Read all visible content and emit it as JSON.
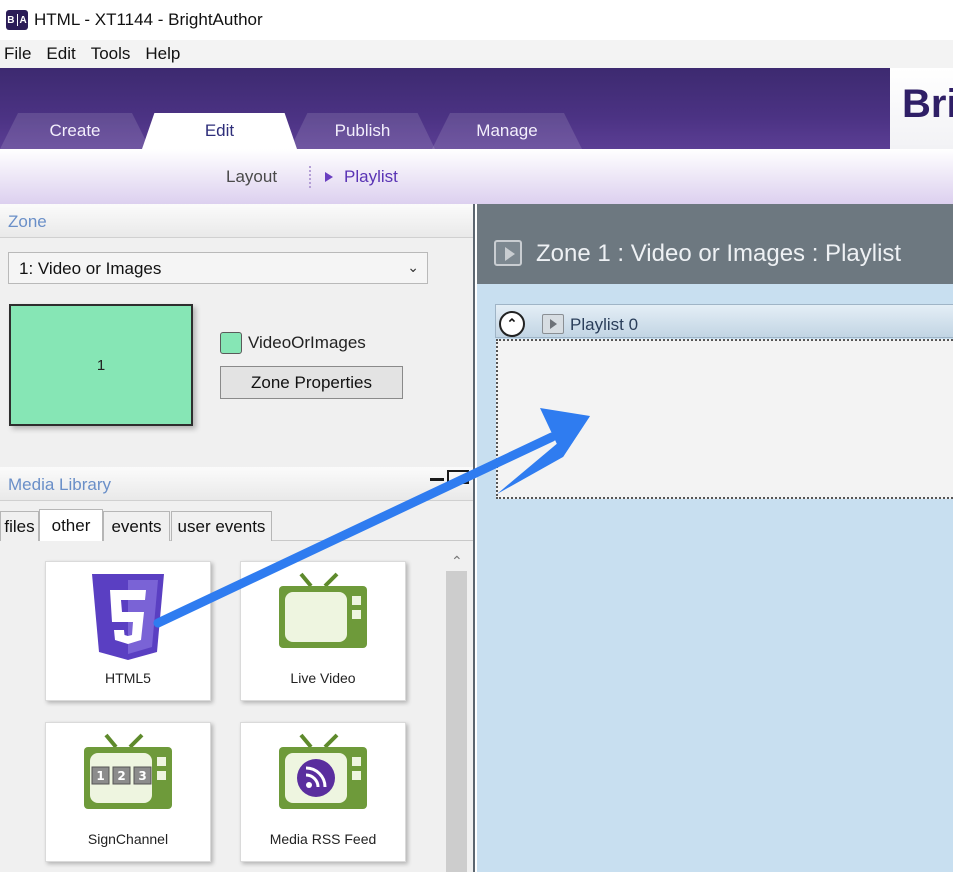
{
  "window": {
    "icon_text_a": "B",
    "icon_text_b": "A",
    "title": "HTML - XT1144 - BrightAuthor"
  },
  "menu": [
    "File",
    "Edit",
    "Tools",
    "Help"
  ],
  "brand": {
    "text": "Bri"
  },
  "tabs": [
    {
      "label": "Create",
      "active": false
    },
    {
      "label": "Edit",
      "active": true
    },
    {
      "label": "Publish",
      "active": false
    },
    {
      "label": "Manage",
      "active": false
    }
  ],
  "subnav": {
    "layout": "Layout",
    "playlist": "Playlist"
  },
  "zone_panel": {
    "header": "Zone",
    "selected_zone": "1: Video or Images",
    "preview_label": "1",
    "zone_type": "VideoOrImages",
    "properties_button": "Zone Properties",
    "zone_color": "#86e6b5"
  },
  "media_library": {
    "header": "Media Library",
    "tabs": [
      {
        "label": "files",
        "active": false
      },
      {
        "label": "other",
        "active": true
      },
      {
        "label": "events",
        "active": false
      },
      {
        "label": "user events",
        "active": false
      }
    ],
    "items": [
      {
        "label": "HTML5",
        "icon": "html5-icon"
      },
      {
        "label": "Live Video",
        "icon": "tv-icon"
      },
      {
        "label": "SignChannel",
        "icon": "signchannel-tv-icon"
      },
      {
        "label": "Media RSS Feed",
        "icon": "rss-tv-icon"
      }
    ],
    "signchannel_digits": [
      "1",
      "2",
      "3"
    ]
  },
  "playlist_panel": {
    "title": "Zone 1 : Video or Images :  Playlist",
    "playlist_name": "Playlist 0"
  },
  "colors": {
    "header_purple": "#4b3283",
    "accent_blue": "#2f7cf0",
    "playlist_bg": "#c8dff0"
  }
}
